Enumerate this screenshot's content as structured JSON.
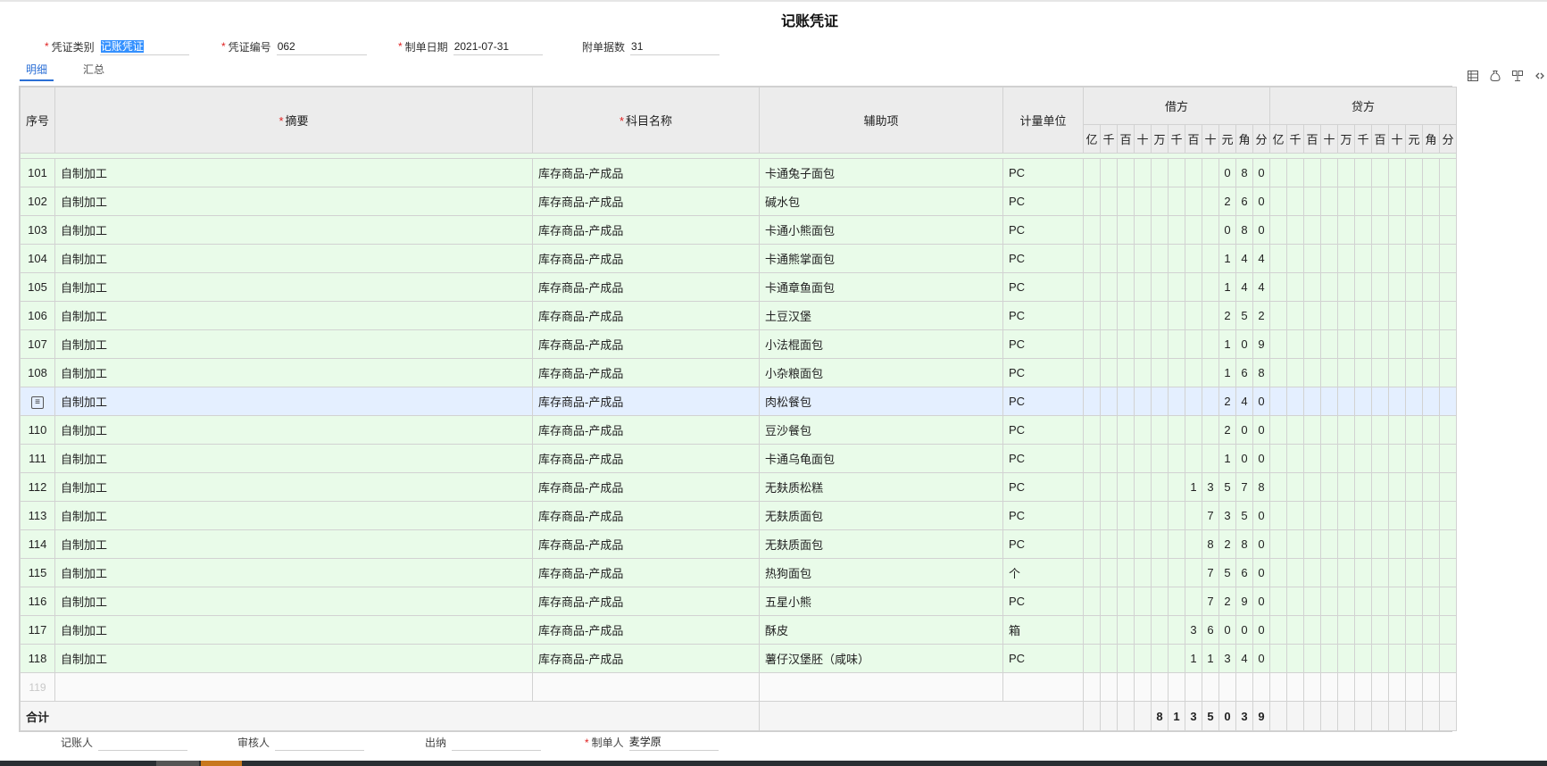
{
  "title": "记账凭证",
  "header": {
    "voucher_type_label": "凭证类别",
    "voucher_type_value": "记账凭证",
    "voucher_no_label": "凭证编号",
    "voucher_no_value": "062",
    "date_label": "制单日期",
    "date_value": "2021-07-31",
    "attachments_label": "附单据数",
    "attachments_value": "31"
  },
  "tabs": [
    {
      "label": "明细",
      "active": true
    },
    {
      "label": "汇总",
      "active": false
    }
  ],
  "toolbar_icons": [
    "insert-row-icon",
    "money-bag-icon",
    "split-icon",
    "link-icon"
  ],
  "columns": {
    "seq": "序号",
    "summary": "摘要",
    "account": "科目名称",
    "aux": "辅助项",
    "unit": "计量单位",
    "debit": "借方",
    "credit": "贷方",
    "digits": [
      "亿",
      "千",
      "百",
      "十",
      "万",
      "千",
      "百",
      "十",
      "元",
      "角",
      "分"
    ]
  },
  "rows": [
    {
      "seq": "101",
      "summary": "自制加工",
      "account": "库存商品-产成品",
      "aux": "卡通兔子面包",
      "unit": "PC",
      "debit": "080"
    },
    {
      "seq": "102",
      "summary": "自制加工",
      "account": "库存商品-产成品",
      "aux": "碱水包",
      "unit": "PC",
      "debit": "260"
    },
    {
      "seq": "103",
      "summary": "自制加工",
      "account": "库存商品-产成品",
      "aux": "卡通小熊面包",
      "unit": "PC",
      "debit": "080"
    },
    {
      "seq": "104",
      "summary": "自制加工",
      "account": "库存商品-产成品",
      "aux": "卡通熊掌面包",
      "unit": "PC",
      "debit": "144"
    },
    {
      "seq": "105",
      "summary": "自制加工",
      "account": "库存商品-产成品",
      "aux": "卡通章鱼面包",
      "unit": "PC",
      "debit": "144"
    },
    {
      "seq": "106",
      "summary": "自制加工",
      "account": "库存商品-产成品",
      "aux": "土豆汉堡",
      "unit": "PC",
      "debit": "252"
    },
    {
      "seq": "107",
      "summary": "自制加工",
      "account": "库存商品-产成品",
      "aux": "小法棍面包",
      "unit": "PC",
      "debit": "109"
    },
    {
      "seq": "108",
      "summary": "自制加工",
      "account": "库存商品-产成品",
      "aux": "小杂粮面包",
      "unit": "PC",
      "debit": "168"
    },
    {
      "seq": "",
      "summary": "自制加工",
      "account": "库存商品-产成品",
      "aux": "肉松餐包",
      "unit": "PC",
      "debit": "240",
      "highlight": true
    },
    {
      "seq": "110",
      "summary": "自制加工",
      "account": "库存商品-产成品",
      "aux": "豆沙餐包",
      "unit": "PC",
      "debit": "200"
    },
    {
      "seq": "111",
      "summary": "自制加工",
      "account": "库存商品-产成品",
      "aux": "卡通乌龟面包",
      "unit": "PC",
      "debit": "100"
    },
    {
      "seq": "112",
      "summary": "自制加工",
      "account": "库存商品-产成品",
      "aux": "无麸质松糕",
      "unit": "PC",
      "debit": "13578"
    },
    {
      "seq": "113",
      "summary": "自制加工",
      "account": "库存商品-产成品",
      "aux": "无麸质面包",
      "unit": "PC",
      "debit": "7350"
    },
    {
      "seq": "114",
      "summary": "自制加工",
      "account": "库存商品-产成品",
      "aux": "无麸质面包",
      "unit": "PC",
      "debit": "8280"
    },
    {
      "seq": "115",
      "summary": "自制加工",
      "account": "库存商品-产成品",
      "aux": "热狗面包",
      "unit": "个",
      "debit": "7560"
    },
    {
      "seq": "116",
      "summary": "自制加工",
      "account": "库存商品-产成品",
      "aux": "五星小熊",
      "unit": "PC",
      "debit": "7290"
    },
    {
      "seq": "117",
      "summary": "自制加工",
      "account": "库存商品-产成品",
      "aux": "酥皮",
      "unit": "箱",
      "debit": "36000"
    },
    {
      "seq": "118",
      "summary": "自制加工",
      "account": "库存商品-产成品",
      "aux": "薯仔汉堡胚（咸味）",
      "unit": "PC",
      "debit": "11340"
    }
  ],
  "empty_row_seq": "119",
  "total": {
    "label": "合计",
    "debit": "8135039"
  },
  "footer": {
    "bookkeeper_label": "记账人",
    "auditor_label": "审核人",
    "cashier_label": "出纳",
    "maker_label": "制单人",
    "maker_value": "麦学原"
  }
}
